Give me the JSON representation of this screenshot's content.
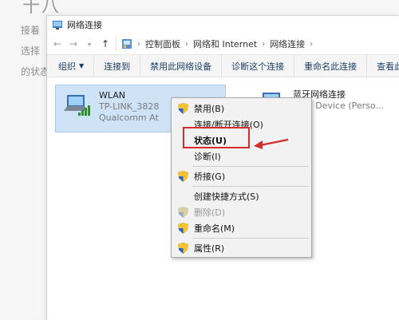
{
  "background": {
    "heading_glyph": "十八",
    "line1": "接着",
    "line2": "选择",
    "line3": "的状态"
  },
  "window": {
    "title": "网络连接",
    "address": {
      "back_icon": "back-arrow-icon",
      "forward_icon": "forward-arrow-icon",
      "up_icon": "up-arrow-icon",
      "path": [
        "控制面板",
        "网络和 Internet",
        "网络连接"
      ]
    },
    "toolbar": {
      "items": [
        "组织",
        "连接到",
        "禁用此网络设备",
        "诊断这个连接",
        "重命名此连接",
        "查看此"
      ]
    },
    "connections": [
      {
        "name": "WLAN",
        "ssid": "TP-LINK_3828",
        "adapter": "Qualcomm At"
      },
      {
        "name": "蓝牙网络连接",
        "ssid": "",
        "adapter": "ooth Device (Perso..."
      }
    ]
  },
  "context_menu": {
    "items": [
      {
        "label": "禁用(B)",
        "shield": true,
        "disabled": false,
        "bold": false
      },
      {
        "label": "连接/断开连接(O)",
        "shield": false,
        "disabled": false,
        "bold": false
      },
      {
        "label": "状态(U)",
        "shield": false,
        "disabled": false,
        "bold": true
      },
      {
        "label": "诊断(I)",
        "shield": false,
        "disabled": false,
        "bold": false
      },
      {
        "label": "桥接(G)",
        "shield": true,
        "disabled": false,
        "bold": false
      },
      {
        "label": "创建快捷方式(S)",
        "shield": false,
        "disabled": false,
        "bold": false
      },
      {
        "label": "删除(D)",
        "shield": true,
        "disabled": true,
        "bold": false
      },
      {
        "label": "重命名(M)",
        "shield": true,
        "disabled": false,
        "bold": false
      },
      {
        "label": "属性(R)",
        "shield": true,
        "disabled": false,
        "bold": false
      }
    ]
  },
  "colors": {
    "highlight": "#d42b2b",
    "selection": "#cfe3f7",
    "link_text": "#1e3f66"
  }
}
